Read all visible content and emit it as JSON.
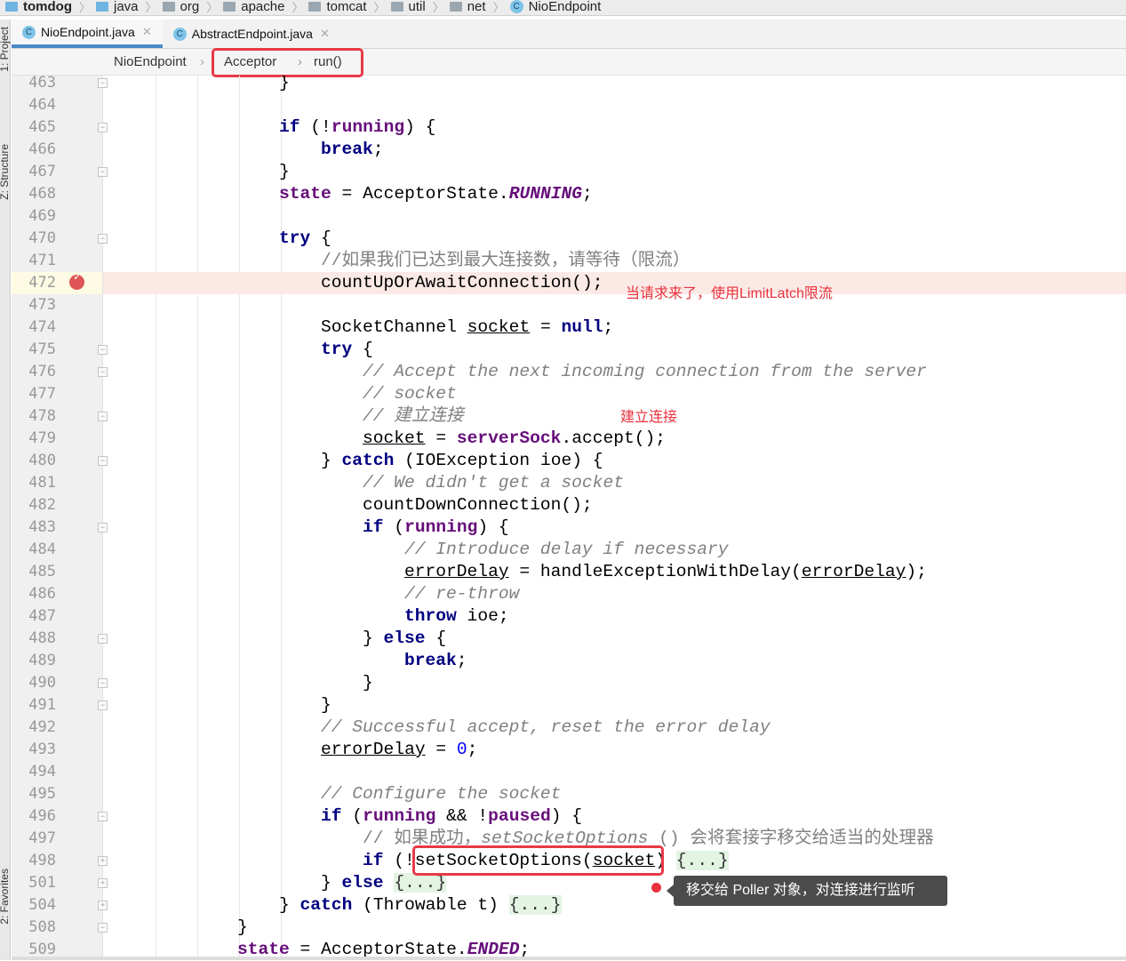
{
  "navbar": {
    "items": [
      {
        "label": "tomdog",
        "icon": "folder-icon",
        "bold": true
      },
      {
        "label": "java",
        "icon": "source-folder-icon"
      },
      {
        "label": "org",
        "icon": "package-icon"
      },
      {
        "label": "apache",
        "icon": "package-icon"
      },
      {
        "label": "tomcat",
        "icon": "package-icon"
      },
      {
        "label": "util",
        "icon": "package-icon"
      },
      {
        "label": "net",
        "icon": "package-icon"
      },
      {
        "label": "NioEndpoint",
        "icon": "class-icon"
      }
    ]
  },
  "tool_windows": {
    "project": "1: Project",
    "structure": "Z: Structure",
    "favorites": "2: Favorites"
  },
  "tabs": [
    {
      "label": "NioEndpoint.java",
      "active": true
    },
    {
      "label": "AbstractEndpoint.java",
      "active": false
    }
  ],
  "breadcrumb": {
    "items": [
      "NioEndpoint",
      "Acceptor",
      "run()"
    ]
  },
  "colors": {
    "keyword": "#000080",
    "field": "#660e7a",
    "comment": "#808080",
    "number": "#0000ff",
    "annotation": "#e8323c",
    "breakpoint_line": "#fbe9e6"
  },
  "current_line": 472,
  "lines": [
    {
      "n": "463",
      "i": 1,
      "t": [
        [
          "}",
          ""
        ]
      ],
      "fold": "end"
    },
    {
      "n": "464",
      "i": 0,
      "t": []
    },
    {
      "n": "465",
      "i": 1,
      "t": [
        [
          "if",
          "kw"
        ],
        [
          " (!",
          ""
        ],
        [
          "running",
          "fd"
        ],
        [
          ") {",
          ""
        ]
      ],
      "fold": "start"
    },
    {
      "n": "466",
      "i": 2,
      "t": [
        [
          "break",
          "kw"
        ],
        [
          ";",
          ""
        ]
      ]
    },
    {
      "n": "467",
      "i": 1,
      "t": [
        [
          "}",
          ""
        ]
      ],
      "fold": "end"
    },
    {
      "n": "468",
      "i": 1,
      "t": [
        [
          "state",
          "fd"
        ],
        [
          " = AcceptorState.",
          ""
        ],
        [
          "RUNNING",
          "st"
        ],
        [
          ";",
          ""
        ]
      ]
    },
    {
      "n": "469",
      "i": 0,
      "t": []
    },
    {
      "n": "470",
      "i": 1,
      "t": [
        [
          "try",
          "kw"
        ],
        [
          " {",
          ""
        ]
      ],
      "fold": "start"
    },
    {
      "n": "471",
      "i": 2,
      "t": [
        [
          "//如果我们已达到最大连接数，请等待（限流）",
          "cn"
        ]
      ]
    },
    {
      "n": "472",
      "i": 2,
      "t": [
        [
          "countUpOrAwaitConnection();",
          ""
        ]
      ]
    },
    {
      "n": "473",
      "i": 0,
      "t": []
    },
    {
      "n": "474",
      "i": 2,
      "t": [
        [
          "SocketChannel ",
          ""
        ],
        [
          "socket",
          "ul"
        ],
        [
          " = ",
          ""
        ],
        [
          "null",
          "kw"
        ],
        [
          ";",
          ""
        ]
      ]
    },
    {
      "n": "475",
      "i": 2,
      "t": [
        [
          "try",
          "kw"
        ],
        [
          " {",
          ""
        ]
      ],
      "fold": "start"
    },
    {
      "n": "476",
      "i": 3,
      "t": [
        [
          "// Accept the next incoming connection from the server",
          "cm"
        ]
      ],
      "fold": "start"
    },
    {
      "n": "477",
      "i": 3,
      "t": [
        [
          "// socket",
          "cm"
        ]
      ]
    },
    {
      "n": "478",
      "i": 3,
      "t": [
        [
          "// 建立连接",
          "cm"
        ]
      ],
      "fold": "end"
    },
    {
      "n": "479",
      "i": 3,
      "t": [
        [
          "socket",
          "ul"
        ],
        [
          " = ",
          ""
        ],
        [
          "serverSock",
          "fd"
        ],
        [
          ".accept();",
          ""
        ]
      ]
    },
    {
      "n": "480",
      "i": 2,
      "t": [
        [
          "} ",
          ""
        ],
        [
          "catch",
          "kw"
        ],
        [
          " (IOException ioe) {",
          ""
        ]
      ],
      "fold": "end"
    },
    {
      "n": "481",
      "i": 3,
      "t": [
        [
          "// We didn't get a socket",
          "cm"
        ]
      ]
    },
    {
      "n": "482",
      "i": 3,
      "t": [
        [
          "countDownConnection();",
          ""
        ]
      ]
    },
    {
      "n": "483",
      "i": 3,
      "t": [
        [
          "if",
          "kw"
        ],
        [
          " (",
          ""
        ],
        [
          "running",
          "fd"
        ],
        [
          ") {",
          ""
        ]
      ],
      "fold": "start"
    },
    {
      "n": "484",
      "i": 4,
      "t": [
        [
          "// Introduce delay if necessary",
          "cm"
        ]
      ]
    },
    {
      "n": "485",
      "i": 4,
      "t": [
        [
          "errorDelay",
          "ul"
        ],
        [
          " = handleExceptionWithDelay(",
          ""
        ],
        [
          "errorDelay",
          "ul"
        ],
        [
          ");",
          ""
        ]
      ]
    },
    {
      "n": "486",
      "i": 4,
      "t": [
        [
          "// re-throw",
          "cm"
        ]
      ]
    },
    {
      "n": "487",
      "i": 4,
      "t": [
        [
          "throw",
          "kw"
        ],
        [
          " ioe;",
          ""
        ]
      ]
    },
    {
      "n": "488",
      "i": 3,
      "t": [
        [
          "} ",
          ""
        ],
        [
          "else",
          "kw"
        ],
        [
          " {",
          ""
        ]
      ],
      "fold": "start"
    },
    {
      "n": "489",
      "i": 4,
      "t": [
        [
          "break",
          "kw"
        ],
        [
          ";",
          ""
        ]
      ]
    },
    {
      "n": "490",
      "i": 3,
      "t": [
        [
          "}",
          ""
        ]
      ],
      "fold": "end"
    },
    {
      "n": "491",
      "i": 2,
      "t": [
        [
          "}",
          ""
        ]
      ],
      "fold": "end"
    },
    {
      "n": "492",
      "i": 2,
      "t": [
        [
          "// Successful accept, reset the error delay",
          "cm"
        ]
      ]
    },
    {
      "n": "493",
      "i": 2,
      "t": [
        [
          "errorDelay",
          "ul"
        ],
        [
          " = ",
          ""
        ],
        [
          "0",
          "num"
        ],
        [
          ";",
          ""
        ]
      ]
    },
    {
      "n": "494",
      "i": 0,
      "t": []
    },
    {
      "n": "495",
      "i": 2,
      "t": [
        [
          "// Configure the socket",
          "cm"
        ]
      ]
    },
    {
      "n": "496",
      "i": 2,
      "t": [
        [
          "if",
          "kw"
        ],
        [
          " (",
          ""
        ],
        [
          "running",
          "fd"
        ],
        [
          " && !",
          ""
        ],
        [
          "paused",
          "fd"
        ],
        [
          ") {",
          ""
        ]
      ],
      "fold": "start"
    },
    {
      "n": "497",
      "i": 3,
      "t": [
        [
          "// 如果成功，",
          "cn"
        ],
        [
          "setSocketOptions",
          "cm"
        ],
        [
          " () 会将套接字移交给适当的处理器",
          "cn"
        ]
      ]
    },
    {
      "n": "498",
      "i": 3,
      "t": [
        [
          "if",
          "kw"
        ],
        [
          " (!setSocketOptions(",
          ""
        ],
        [
          "socket",
          "ul"
        ],
        [
          ") ",
          ""
        ],
        [
          "{...}",
          "fold"
        ]
      ],
      "fold": "plus"
    },
    {
      "n": "501",
      "i": 2,
      "t": [
        [
          "} ",
          ""
        ],
        [
          "else",
          "kw"
        ],
        [
          " ",
          ""
        ],
        [
          "{...}",
          "fold"
        ]
      ],
      "fold": "plus"
    },
    {
      "n": "504",
      "i": 1,
      "t": [
        [
          "} ",
          ""
        ],
        [
          "catch",
          "kw"
        ],
        [
          " (Throwable t) ",
          ""
        ],
        [
          "{...}",
          "fold"
        ]
      ],
      "fold": "plus"
    },
    {
      "n": "508",
      "i": 0,
      "t": [
        [
          "}",
          ""
        ]
      ],
      "fold": "end"
    },
    {
      "n": "509",
      "i": 0,
      "t": [
        [
          "state",
          "fd"
        ],
        [
          " = AcceptorState.",
          ""
        ],
        [
          "ENDED",
          "st"
        ],
        [
          ";",
          ""
        ]
      ]
    }
  ],
  "annotations": {
    "limit_latch": "当请求来了，使用LimitLatch限流",
    "accept": "建立连接",
    "tooltip": "移交给 Poller 对象，对连接进行监听"
  }
}
